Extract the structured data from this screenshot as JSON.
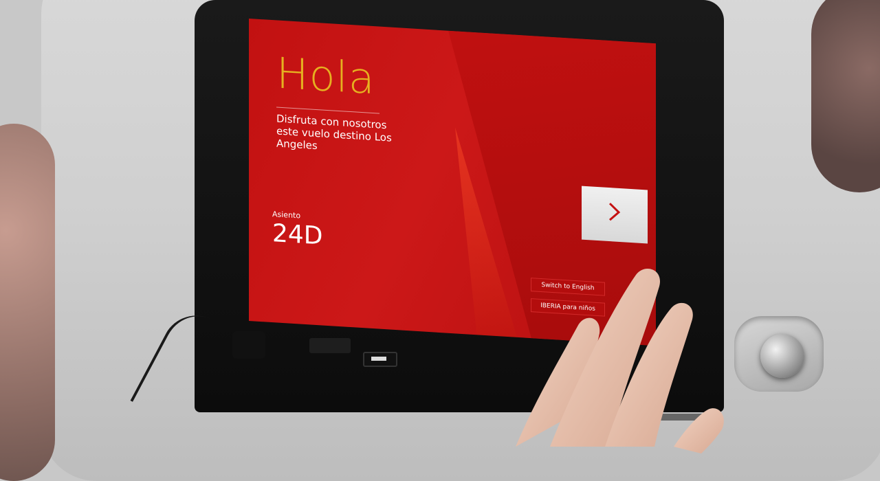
{
  "greeting": "Hola",
  "welcome_message": "Disfruta con nosotros este vuelo destino Los Angeles",
  "seat": {
    "label": "Asiento",
    "value": "24D"
  },
  "next_button": {
    "icon": "chevron-right-icon"
  },
  "links": {
    "switch_language": "Switch to English",
    "kids": "IBERIA para niños"
  },
  "colors": {
    "screen_red": "#c41414",
    "greeting_gold": "#e6b020",
    "button_grey": "#e4e4e4"
  }
}
